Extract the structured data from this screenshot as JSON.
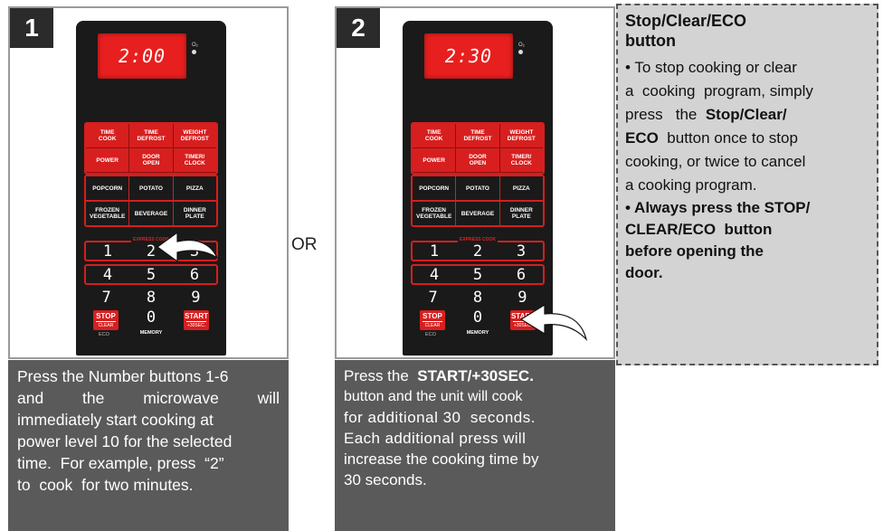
{
  "step1": {
    "number": "1",
    "display": "2:00",
    "caption_lines": [
      [
        "Press the Number buttons 1-6"
      ],
      [
        "and",
        "the",
        "microwave",
        "will"
      ],
      [
        "immediately start cooking at"
      ],
      [
        "power level 10 for the selected"
      ],
      [
        "time.  For example, press  “2”"
      ],
      [
        "to  cook  for two minutes."
      ]
    ]
  },
  "step2": {
    "number": "2",
    "display": "2:30",
    "caption_lead": "Press the ",
    "caption_bold": "START/+30SEC.",
    "caption_lines": [
      "button and the unit will cook",
      "for additional 30  seconds.",
      "Each additional press will",
      "increase the cooking time by",
      "30 seconds."
    ]
  },
  "or_label": "OR",
  "panel": {
    "indicator": "O₂",
    "row1": [
      "TIME\nCOOK",
      "TIME\nDEFROST",
      "WEIGHT\nDEFROST"
    ],
    "row2": [
      "POWER",
      "DOOR\nOPEN",
      "TIMER/\nCLOCK"
    ],
    "row3": [
      "POPCORN",
      "POTATO",
      "PIZZA"
    ],
    "row4": [
      "FROZEN\nVEGETABLE",
      "BEVERAGE",
      "DINNER\nPLATE"
    ],
    "express": "EXPRESS COOK",
    "nums": [
      "1",
      "2",
      "3",
      "4",
      "5",
      "6",
      "7",
      "8",
      "9",
      "0"
    ],
    "stop": "STOP",
    "clear": "CLEAR",
    "eco": "ECO",
    "memory": "MEMORY",
    "start": "START",
    "plus30": "+30SEC."
  },
  "info": {
    "title_line1": "Stop/Clear/ECO",
    "title_line2": "button",
    "p1_a": "• To stop cooking or clear",
    "p1_b": "a  cooking  program, simply",
    "p1_c_pre": "press   the  ",
    "p1_c_bold": "Stop/Clear/",
    "p1_d_bold": "ECO",
    "p1_d_rest": "  button once to stop",
    "p1_e": "cooking, or twice to cancel",
    "p1_f": "a cooking program.",
    "p2_lines": [
      "• Always press the STOP/",
      "CLEAR/ECO  button",
      "before opening the",
      "door."
    ]
  }
}
